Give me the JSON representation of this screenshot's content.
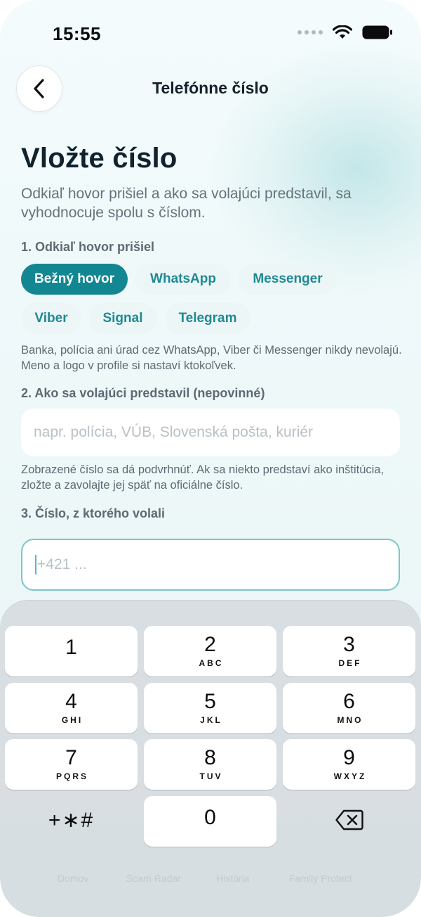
{
  "status_bar": {
    "time": "15:55"
  },
  "nav": {
    "title": "Telefónne číslo",
    "back_icon": "chevron-left-icon"
  },
  "headline": "Vložte číslo",
  "subtext": "Odkiaľ hovor prišiel a ako sa volajúci predstavil, sa vyhodnocuje spolu s číslom.",
  "section1": {
    "label": "1. Odkiaľ hovor prišiel",
    "chips": [
      "Bežný hovor",
      "WhatsApp",
      "Messenger",
      "Viber",
      "Signal",
      "Telegram"
    ],
    "selected": "Bežný hovor",
    "note": "Banka, polícia ani úrad cez WhatsApp, Viber či Messenger nikdy nevolajú. Meno a logo v profile si nastaví ktokoľvek."
  },
  "section2": {
    "label": "2. Ako sa volajúci predstavil (nepovinné)",
    "placeholder": "napr. polícia, VÚB, Slovenská pošta, kuriér",
    "note": "Zobrazené číslo sa dá podvrhnúť. Ak sa niekto predstaví ako inštitúcia, zložte a zavolajte jej späť na oficiálne číslo."
  },
  "section3": {
    "label": "3. Číslo, z ktorého volali",
    "placeholder": "+421 ..."
  },
  "keypad": {
    "keys": [
      {
        "num": "1",
        "letters": ""
      },
      {
        "num": "2",
        "letters": "ABC"
      },
      {
        "num": "3",
        "letters": "DEF"
      },
      {
        "num": "4",
        "letters": "GHI"
      },
      {
        "num": "5",
        "letters": "JKL"
      },
      {
        "num": "6",
        "letters": "MNO"
      },
      {
        "num": "7",
        "letters": "PQRS"
      },
      {
        "num": "8",
        "letters": "TUV"
      },
      {
        "num": "9",
        "letters": "WXYZ"
      },
      {
        "num": "0",
        "letters": ""
      }
    ],
    "symbols": "+∗#",
    "delete_icon": "backspace-icon"
  },
  "tab_bar_behind": [
    "Domov",
    "Scam Radar",
    "História",
    "Family Protect"
  ],
  "colors": {
    "accent": "#128791",
    "accent_text": "#1f8a94",
    "headline": "#10222e"
  }
}
